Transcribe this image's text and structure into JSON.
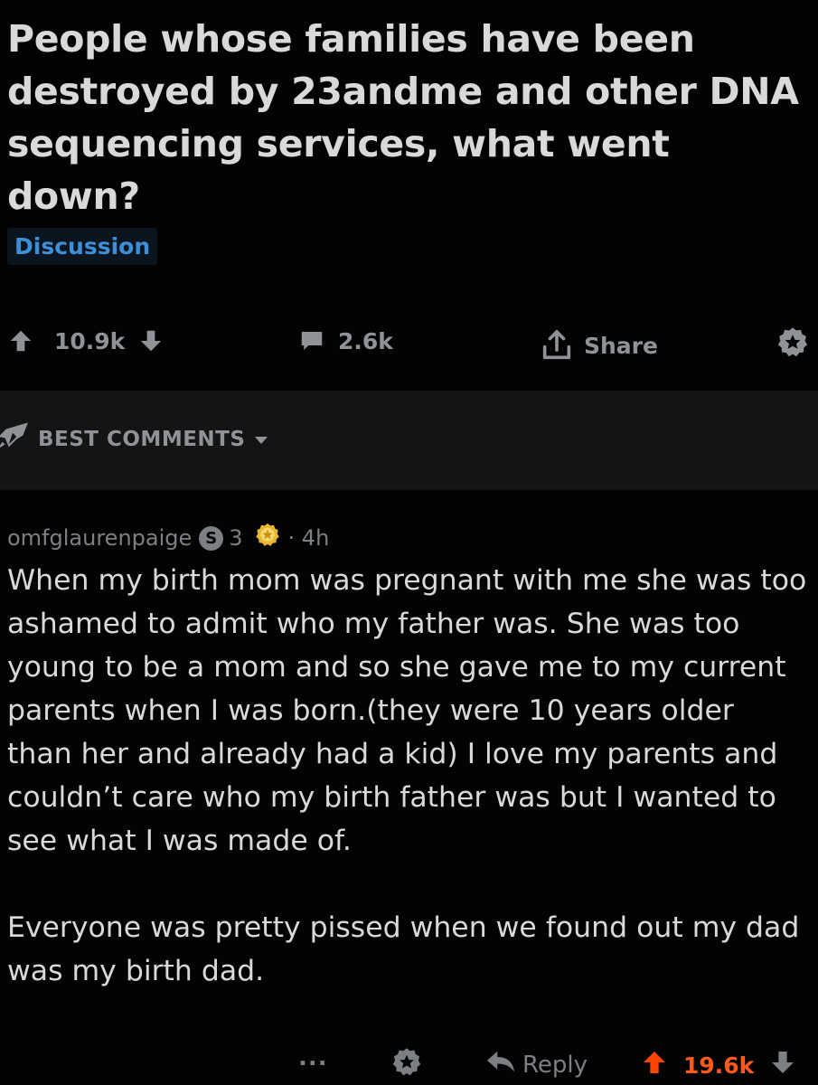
{
  "post": {
    "title": "People whose families have been destroyed by 23andme and other DNA sequencing services, what went down?",
    "flair": "Discussion",
    "score": "10.9k",
    "comments_count": "2.6k",
    "share_label": "Share"
  },
  "sort": {
    "label": "BEST COMMENTS"
  },
  "comment": {
    "author": "omfglaurenpaige",
    "karma_badge": "S",
    "karma_count": "3",
    "age": "· 4h",
    "paragraphs": [
      "When my birth mom was pregnant with me she was too ashamed to admit who my father was. She was too young to be a mom and so she gave me to my current parents when I was born.(they were 10 years older than her and already had a kid) I love my parents and couldn’t care who my birth father was but I wanted to see what I was made of.",
      "Everyone was pretty pissed when we found out my dad was my birth dad."
    ],
    "more_label": "...",
    "reply_label": "Reply",
    "score": "19.6k"
  },
  "colors": {
    "upvote_active": "#ff4500",
    "upvote_score_active": "#ff5a1a",
    "flair_text": "#3e8ed8",
    "award_gold": "#e8b830"
  },
  "icons": {
    "post_upvote": "arrow-up-icon",
    "post_downvote": "arrow-down-icon",
    "comments": "speech-bubble-icon",
    "share": "share-icon",
    "award": "award-icon",
    "sort": "rocket-icon",
    "sort_chevron": "caret-down-icon"
  }
}
